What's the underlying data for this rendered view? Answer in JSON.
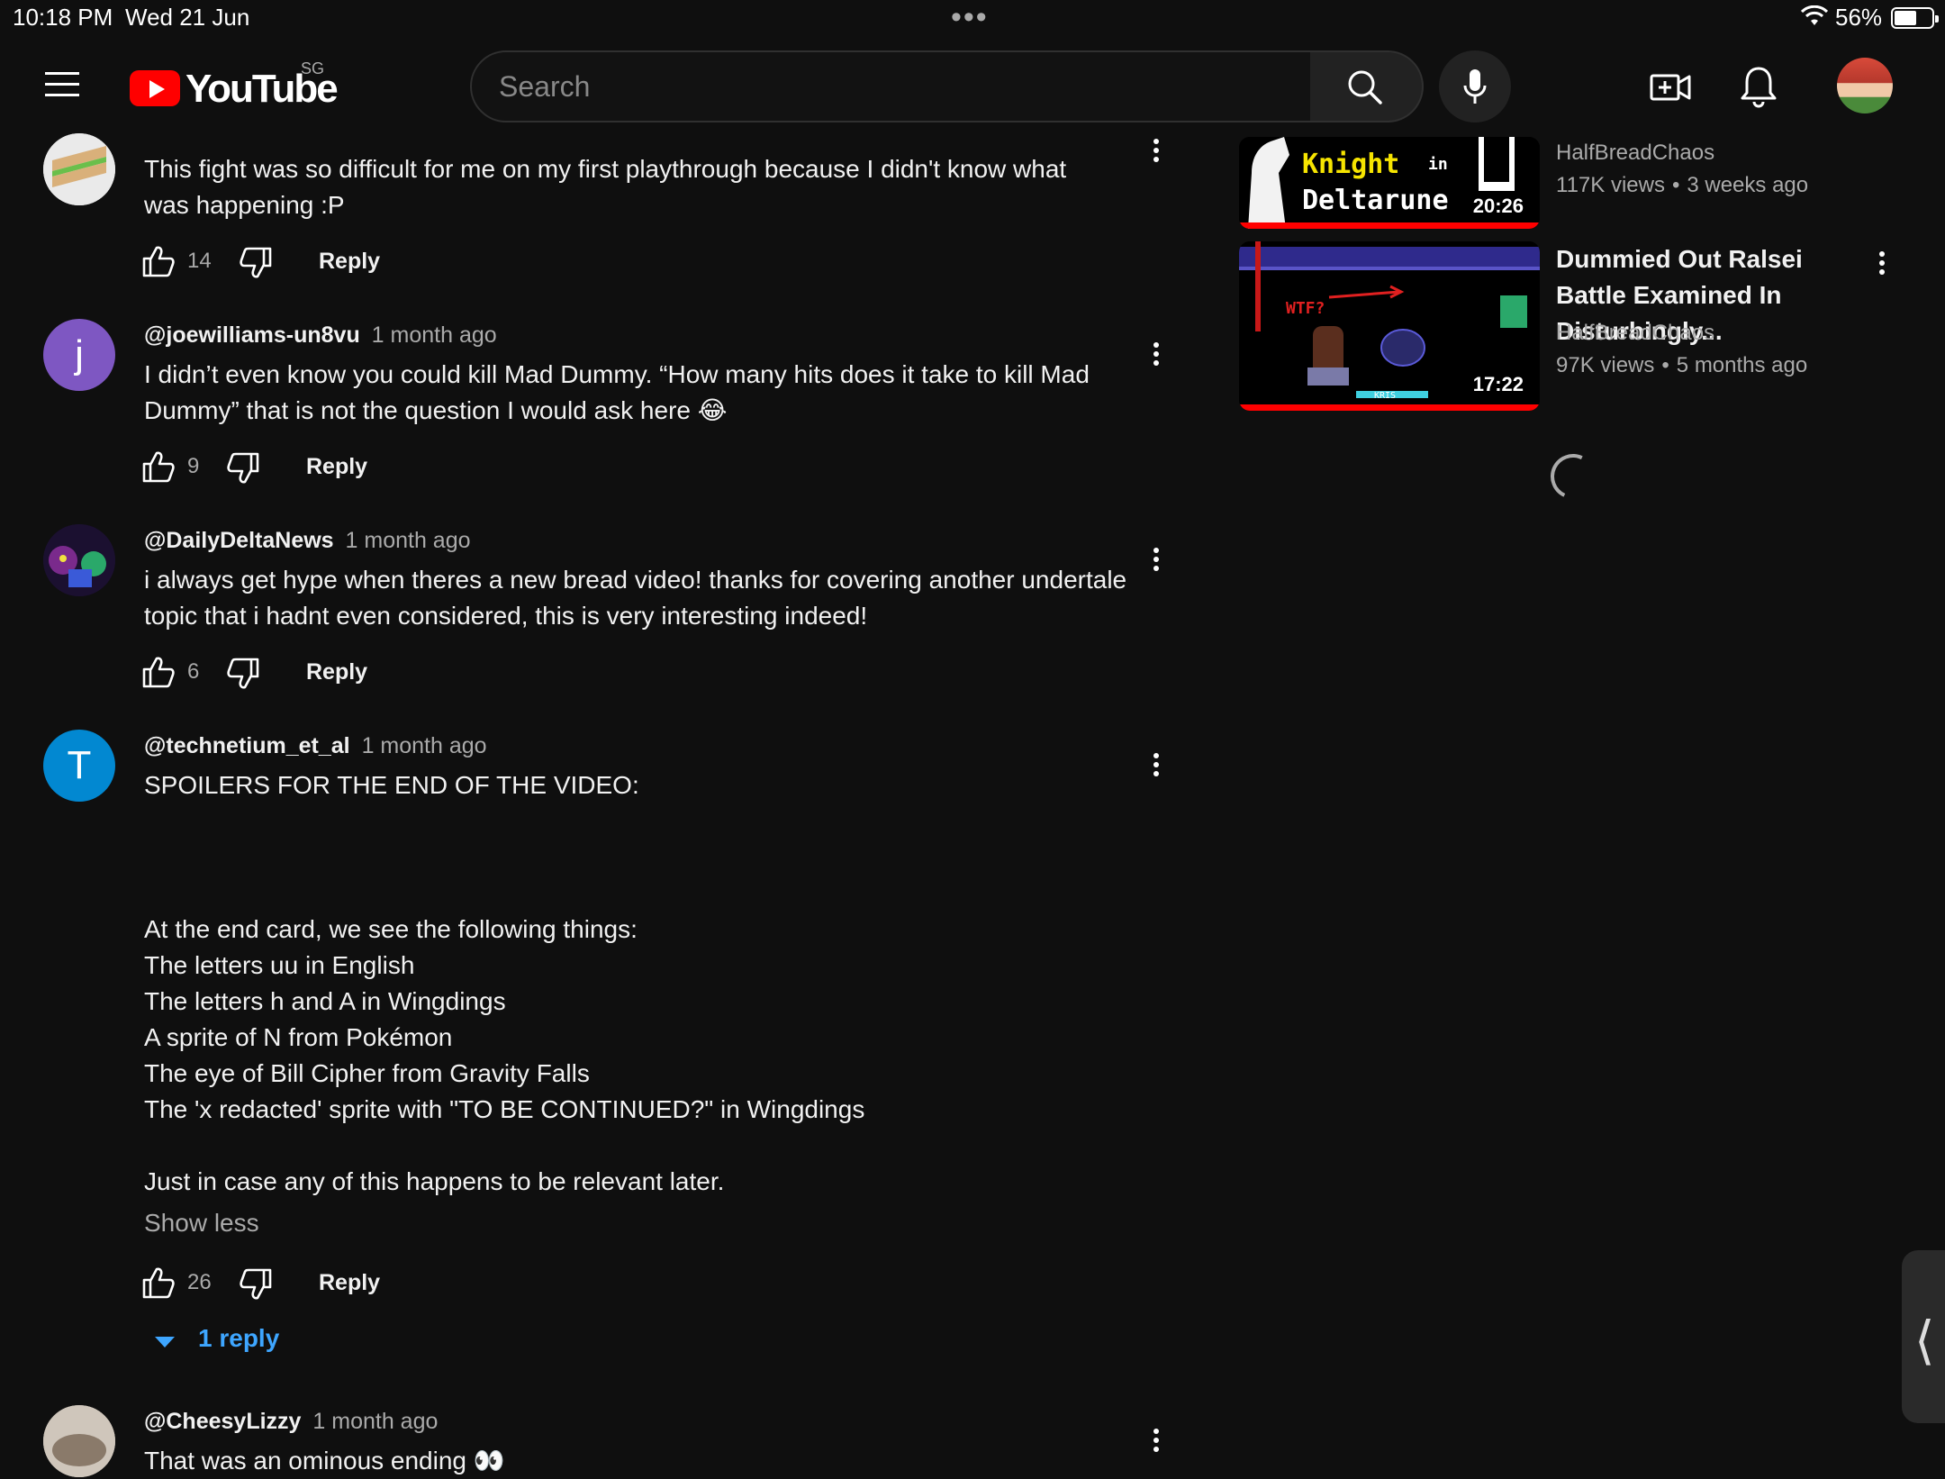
{
  "status_bar": {
    "time": "10:18 PM",
    "date": "Wed 21 Jun",
    "battery_pct": "56%",
    "battery_level": 0.56
  },
  "masthead": {
    "logo_text": "YouTube",
    "region": "SG",
    "search_placeholder": "Search",
    "icons": [
      "menu-icon",
      "search-icon",
      "microphone-icon",
      "create-video-icon",
      "bell-icon",
      "avatar"
    ]
  },
  "comments": [
    {
      "author": "",
      "age": "",
      "text": "This fight was so difficult for me on my first playthrough because I didn't know what\nwas happening :P",
      "likes": "14",
      "reply_label": "Reply"
    },
    {
      "author": "@joewilliams-un8vu",
      "age": "1 month ago",
      "avatar_letter": "j",
      "avatar_color": "#7e57c2",
      "text": "I didn’t even know you could kill Mad Dummy. “How many hits does it take to kill Mad\nDummy” that is not the question I would ask here 😂",
      "likes": "9",
      "reply_label": "Reply"
    },
    {
      "author": "@DailyDeltaNews",
      "age": "1 month ago",
      "text": "i always get hype when theres a new bread video! thanks for covering another undertale\ntopic that i hadnt even considered, this is very interesting indeed!",
      "likes": "6",
      "reply_label": "Reply"
    },
    {
      "author": "@technetium_et_al",
      "age": "1 month ago",
      "avatar_letter": "T",
      "avatar_color": "#0288d1",
      "text": "SPOILERS FOR THE END OF THE VIDEO:\n\n\n\nAt the end card, we see the following things:\nThe letters uu in English\nThe letters h and A in Wingdings\nA sprite of N from Pokémon\nThe eye of Bill Cipher from Gravity Falls\nThe 'x redacted' sprite with \"TO BE CONTINUED?\" in Wingdings\n\nJust in case any of this happens to be relevant later.",
      "show_less": "Show less",
      "likes": "26",
      "reply_label": "Reply",
      "replies_label": "1 reply"
    },
    {
      "author": "@CheesyLizzy",
      "age": "1 month ago",
      "text": "That was an ominous ending 👀"
    }
  ],
  "related": [
    {
      "title": "",
      "thumb_text_1": "Knight",
      "thumb_text_2": "in",
      "thumb_text_3": "Deltarune",
      "duration": "20:26",
      "channel": "HalfBreadChaos",
      "views": "117K views",
      "age": "3 weeks ago",
      "sep": "•"
    },
    {
      "title": "Dummied Out Ralsei Battle Examined In Disturbingly...",
      "thumb_text_wtf": "WTF?",
      "thumb_text_kris": "KRIS",
      "duration": "17:22",
      "channel": "HalfBreadChaos",
      "views": "97K views",
      "age": "5 months ago",
      "sep": "•"
    }
  ]
}
